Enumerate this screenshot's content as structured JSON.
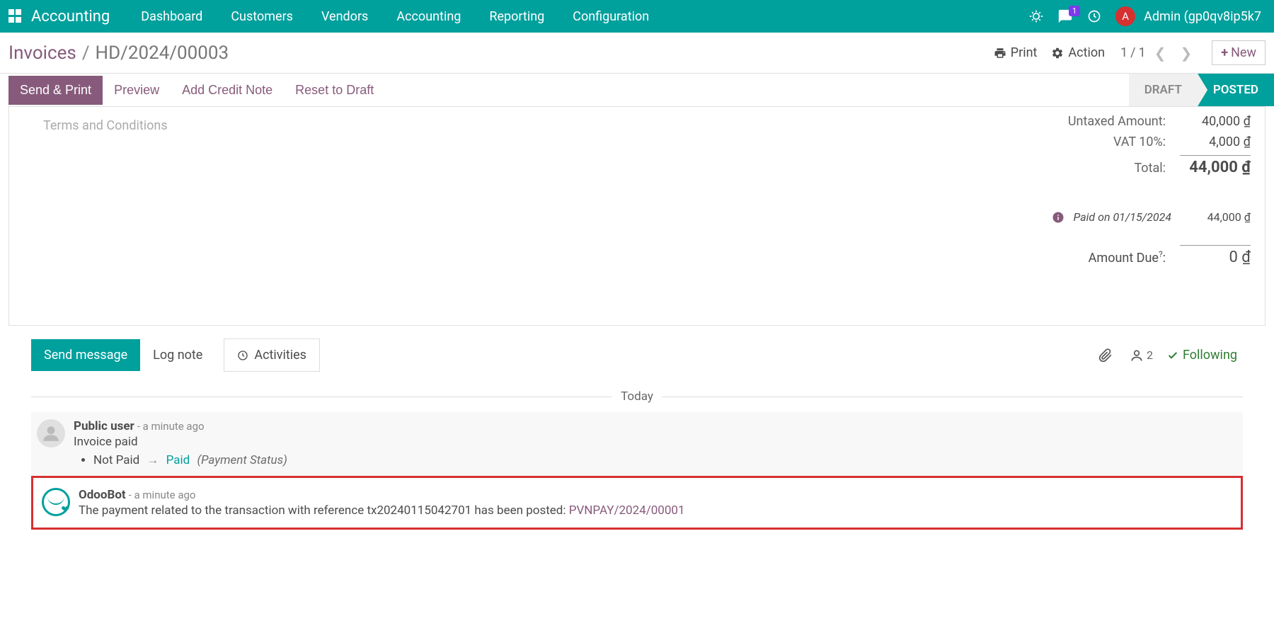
{
  "topnav": {
    "brand": "Accounting",
    "menus": [
      "Dashboard",
      "Customers",
      "Vendors",
      "Accounting",
      "Reporting",
      "Configuration"
    ],
    "messages_badge": "1",
    "avatar_initial": "A",
    "user_name": "Admin (gp0qv8ip5k7"
  },
  "breadcrumb": {
    "root": "Invoices",
    "current": "HD/2024/00003"
  },
  "control": {
    "print": "Print",
    "action": "Action",
    "page_current": "1",
    "page_sep": "/",
    "page_total": "1",
    "new": "New"
  },
  "statusbar": {
    "send_print": "Send & Print",
    "preview": "Preview",
    "credit_note": "Add Credit Note",
    "reset": "Reset to Draft",
    "draft": "DRAFT",
    "posted": "POSTED"
  },
  "form": {
    "terms_placeholder": "Terms and Conditions",
    "totals": {
      "untaxed_label": "Untaxed Amount:",
      "untaxed_value": "40,000 ₫",
      "vat_label": "VAT 10%:",
      "vat_value": "4,000 ₫",
      "total_label": "Total:",
      "total_value": "44,000 ₫",
      "paid_on": "Paid on 01/15/2024",
      "paid_value": "44,000 ₫",
      "due_label": "Amount Due",
      "due_q": "?",
      "due_colon": ":",
      "due_value": "0 ₫"
    }
  },
  "chatter": {
    "send_message": "Send message",
    "log_note": "Log note",
    "activities": "Activities",
    "followers_count": "2",
    "following": "Following",
    "today": "Today",
    "messages": [
      {
        "author": "Public user",
        "time": "- a minute ago",
        "body": "Invoice paid",
        "change_from": "Not Paid",
        "change_to": "Paid",
        "change_field": "(Payment Status)"
      },
      {
        "author": "OdooBot",
        "time": "- a minute ago",
        "body_pre": "The payment related to the transaction with reference tx20240115042701 has been posted: ",
        "body_link": "PVNPAY/2024/00001"
      }
    ]
  }
}
